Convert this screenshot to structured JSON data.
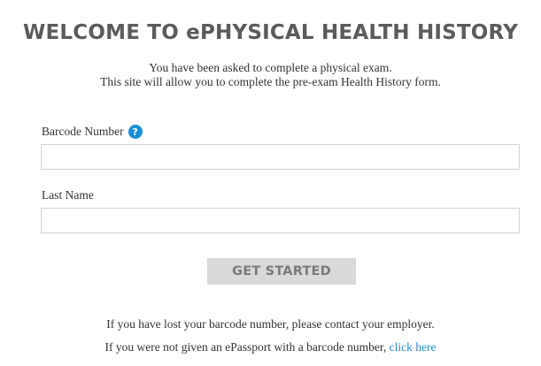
{
  "header": {
    "title": "WELCOME TO ePHYSICAL HEALTH HISTORY",
    "intro_line_1": "You have been asked to complete a physical exam.",
    "intro_line_2": "This site will allow you to complete the pre-exam Health History form."
  },
  "form": {
    "barcode_label": "Barcode Number",
    "barcode_help_icon": "question-circle-icon",
    "barcode_help_glyph": "?",
    "barcode_value": "",
    "barcode_placeholder": "",
    "lastname_label": "Last Name",
    "lastname_value": "",
    "lastname_placeholder": "",
    "submit_label": "GET STARTED"
  },
  "footer": {
    "lost_barcode_text": "If you have lost your barcode number, please contact your employer.",
    "no_passport_text": "If you were not given an ePassport with a barcode number,",
    "click_here_label": "click here"
  },
  "colors": {
    "title": "#5b5b5b",
    "link": "#1a8fd6",
    "button_bg": "#d9d9d9",
    "button_text": "#7a7a7a",
    "input_border": "#d4d4d4"
  }
}
